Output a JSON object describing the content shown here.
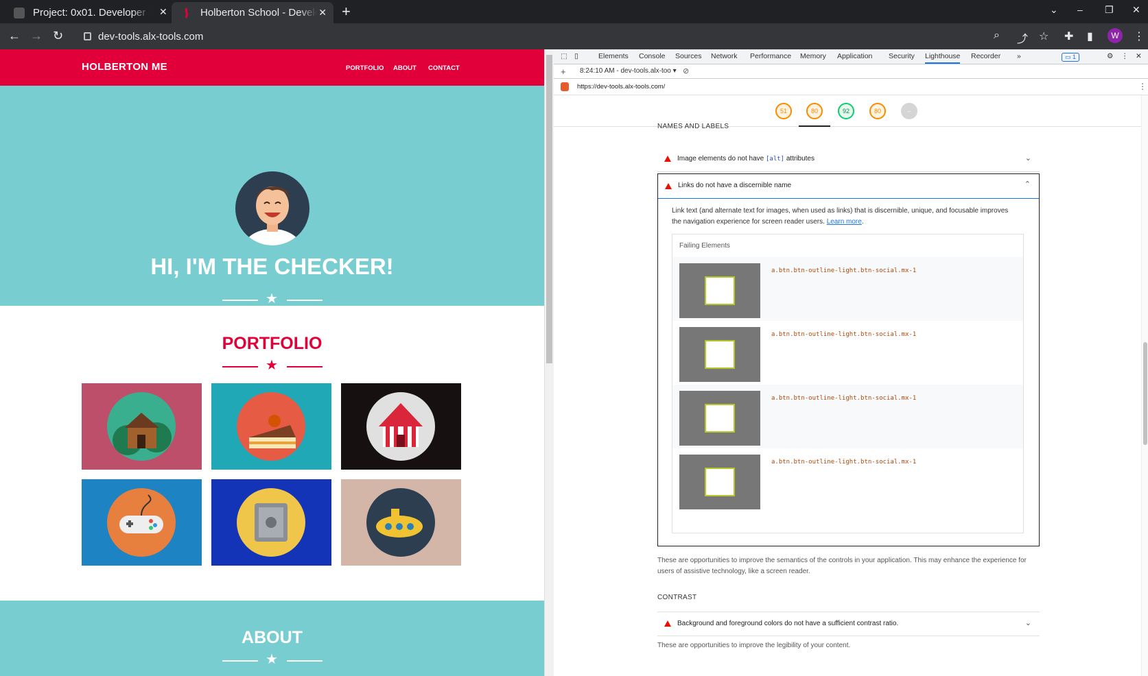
{
  "browser": {
    "tabs": [
      {
        "title": "Project: 0x01. Developer t",
        "active": false
      },
      {
        "title": "Holberton School - Develo",
        "active": true
      }
    ],
    "url": "dev-tools.alx-tools.com",
    "profile_initial": "W"
  },
  "site": {
    "brand": "HOLBERTON ME",
    "nav": [
      "PORTFOLIO",
      "ABOUT",
      "CONTACT"
    ],
    "hero_title": "HI, I'M THE CHECKER!",
    "portfolio_title": "PORTFOLIO",
    "about_title": "ABOUT",
    "tiles": [
      {
        "icon": "cabin-icon",
        "bg": "#bd4f6b",
        "circle": "#3aaf8f"
      },
      {
        "icon": "cake-icon",
        "bg": "#21a8b6",
        "circle": "#e55b44"
      },
      {
        "icon": "circus-tent-icon",
        "bg": "#161010",
        "circle": "#e0e0e0"
      },
      {
        "icon": "game-controller-icon",
        "bg": "#1e83c3",
        "circle": "#e7803f"
      },
      {
        "icon": "safe-icon",
        "bg": "#1334b7",
        "circle": "#f0c64a"
      },
      {
        "icon": "submarine-icon",
        "bg": "#d3b6a8",
        "circle": "#2c3e50"
      }
    ],
    "colors": {
      "primary": "#e2003b",
      "teal": "#78cdd1"
    }
  },
  "devtools": {
    "tabs": [
      "Elements",
      "Console",
      "Sources",
      "Network",
      "Performance",
      "Memory",
      "Application",
      "Security",
      "Lighthouse",
      "Recorder"
    ],
    "selected_tab": "Lighthouse",
    "issues_count": "1",
    "report_time": "8:24:10 AM - dev-tools.alx-too ▾",
    "report_url": "https://dev-tools.alx-tools.com/",
    "scores": [
      {
        "value": "51",
        "color": "#fa8a00"
      },
      {
        "value": "80",
        "color": "#fa8a00"
      },
      {
        "value": "92",
        "color": "#0cce6b"
      },
      {
        "value": "80",
        "color": "#fa8a00"
      },
      {
        "value": "–",
        "color": "#bdbdbd"
      }
    ],
    "names_labels_header": "NAMES AND LABELS",
    "audit_img_alt_prefix": "Image elements do not have ",
    "audit_img_alt_code": "[alt]",
    "audit_img_alt_suffix": " attributes",
    "audit_links_name": "Links do not have a discernible name",
    "links_desc": "Link text (and alternate text for images, when used as links) that is discernible, unique, and focusable improves the navigation experience for screen reader users.",
    "learn_more": "Learn more",
    "failing_elements": "Failing Elements",
    "failing_items": [
      "a.btn.btn-outline-light.btn-social.mx-1",
      "a.btn.btn-outline-light.btn-social.mx-1",
      "a.btn.btn-outline-light.btn-social.mx-1",
      "a.btn.btn-outline-light.btn-social.mx-1"
    ],
    "names_note": "These are opportunities to improve the semantics of the controls in your application. This may enhance the experience for users of assistive technology, like a screen reader.",
    "contrast_header": "CONTRAST",
    "audit_contrast": "Background and foreground colors do not have a sufficient contrast ratio.",
    "contrast_note": "These are opportunities to improve the legibility of your content."
  }
}
